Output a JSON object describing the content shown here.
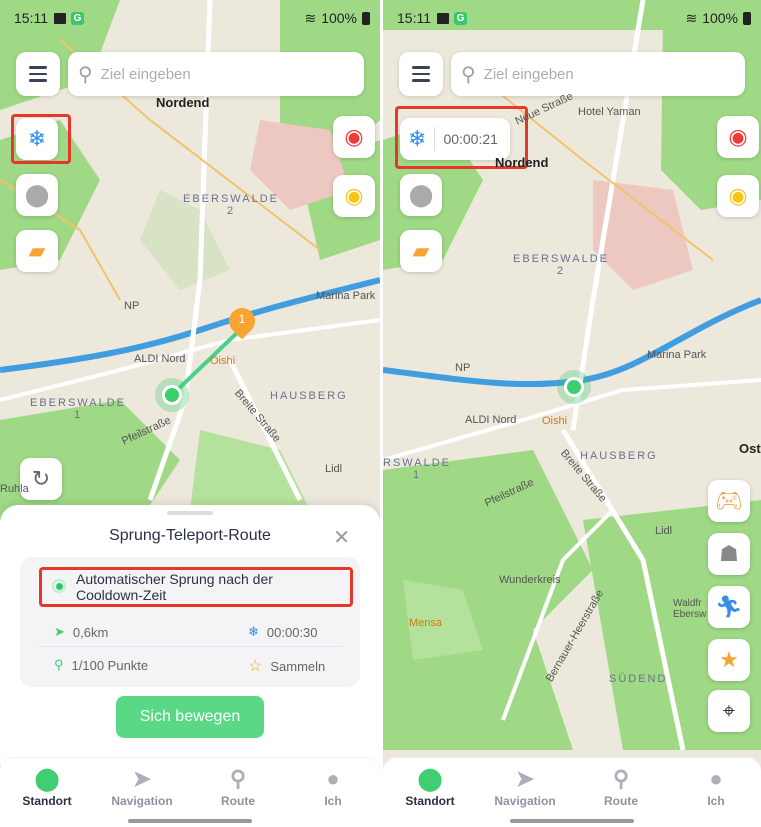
{
  "colors": {
    "accent": "#3fcf72",
    "highlight": "#e5382a",
    "snow": "#2a8ef0"
  },
  "left": {
    "status": {
      "time": "15:11",
      "battery": "100%"
    },
    "search": {
      "placeholder": "Ziel eingeben"
    },
    "map_labels": [
      "Nordend",
      "EBERSWALDE\n2",
      "Marina Park",
      "NP",
      "ALDI Nord",
      "Oishi",
      "EBERSWALDE\n1",
      "HAUSBERG",
      "Breite Straße",
      "Pfeilstraße",
      "Lidl",
      "Ruhla"
    ],
    "waypoint_number": "1",
    "sheet": {
      "title": "Sprung-Teleport-Route",
      "option": "Automatischer Sprung nach der Cooldown-Zeit",
      "distance": "0,6km",
      "cooldown": "00:00:30",
      "points": "1/100 Punkte",
      "collect": "Sammeln",
      "button": "Sich bewegen"
    }
  },
  "right": {
    "status": {
      "time": "15:11",
      "battery": "100%"
    },
    "search": {
      "placeholder": "Ziel eingeben"
    },
    "timer": "00:00:21",
    "map_labels": [
      "Neue Straße",
      "Hotel Yaman",
      "Nordend",
      "EBERSWALDE\n2",
      "Marina Park",
      "NP",
      "ALDI Nord",
      "Oishi",
      "HAUSBERG",
      "RSWALDE\n1",
      "Breite Straße",
      "Pfeilstraße",
      "Lidl",
      "Wunderkreis",
      "Mensa",
      "Bernauer-Heerstraße",
      "SÜDEND",
      "Waldfr\nEbersw",
      "Ost"
    ]
  },
  "nav": [
    {
      "label": "Standort",
      "icon": "location-pin-icon"
    },
    {
      "label": "Navigation",
      "icon": "paper-plane-icon"
    },
    {
      "label": "Route",
      "icon": "route-icon"
    },
    {
      "label": "Ich",
      "icon": "person-icon"
    }
  ]
}
